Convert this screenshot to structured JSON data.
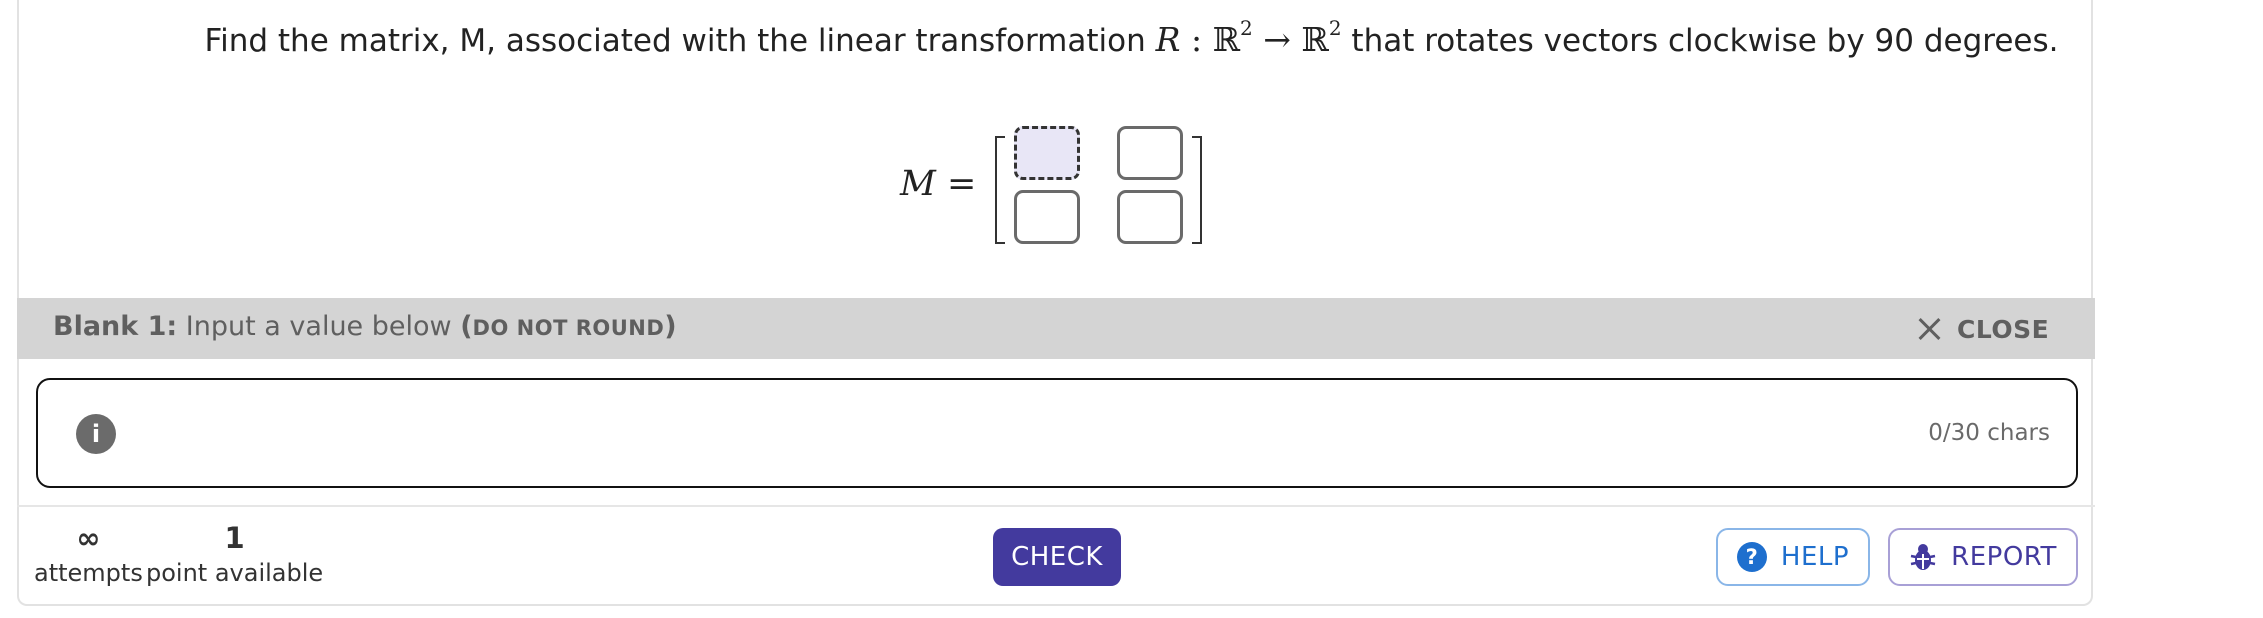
{
  "question": {
    "prefix": "Find the matrix, M, associated with the linear transformation ",
    "map_name": "R",
    "map_colon": " : ",
    "domain": "ℝ",
    "domain_exp": "2",
    "arrow": " → ",
    "codomain": "ℝ",
    "codomain_exp": "2",
    "suffix": " that rotates vectors clockwise by 90 degrees."
  },
  "matrix": {
    "label": "M",
    "equals": " =",
    "cells": [
      "",
      "",
      "",
      ""
    ]
  },
  "blank_bar": {
    "blank_label": "Blank 1:",
    "instruction": " Input a value below ",
    "paren_open": "(",
    "note": "DO NOT ROUND",
    "paren_close": ")",
    "close_label": "CLOSE"
  },
  "input": {
    "value": "",
    "char_count": "0/30 chars"
  },
  "footer": {
    "attempts_value": "∞",
    "attempts_label": "attempts",
    "points_value": "1",
    "points_label": "point available",
    "check_label": "CHECK",
    "help_label": "HELP",
    "report_label": "REPORT"
  },
  "colors": {
    "primary": "#433a9e",
    "help_blue": "#1e6fce",
    "bar_gray": "#d4d4d4",
    "active_blank": "#e8e6f6"
  },
  "icons": {
    "info": "info-icon",
    "close": "close-icon",
    "help": "question-circle-icon",
    "report": "bug-icon"
  }
}
